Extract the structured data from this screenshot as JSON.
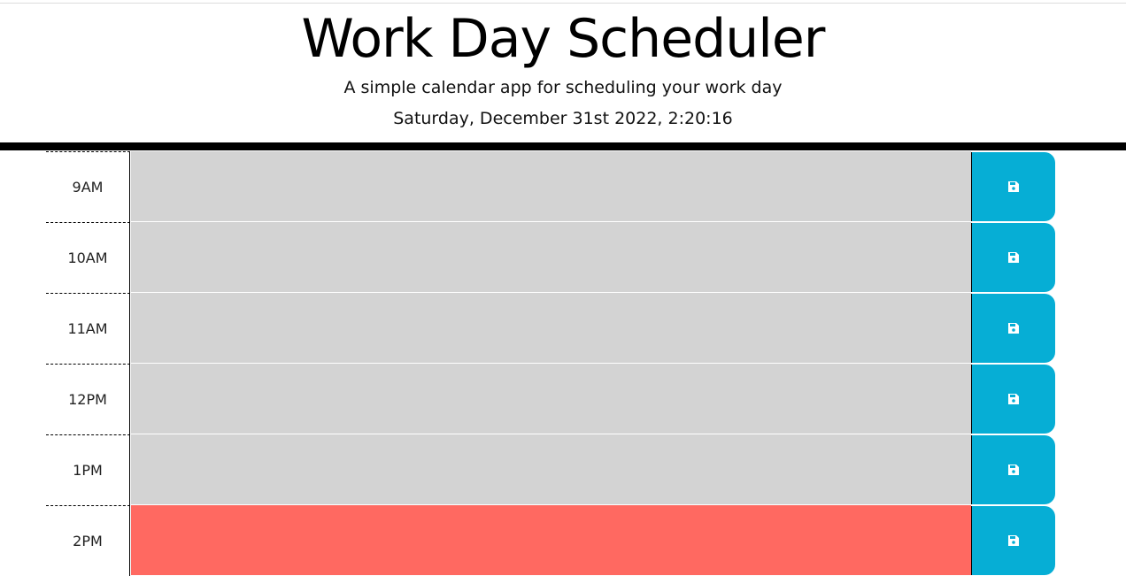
{
  "header": {
    "title": "Work Day Scheduler",
    "subtitle": "A simple calendar app for scheduling your work day",
    "current_day": "Saturday, December 31st 2022, 2:20:16"
  },
  "rows": [
    {
      "hour": "9AM",
      "status": "past",
      "text": ""
    },
    {
      "hour": "10AM",
      "status": "past",
      "text": ""
    },
    {
      "hour": "11AM",
      "status": "past",
      "text": ""
    },
    {
      "hour": "12PM",
      "status": "past",
      "text": ""
    },
    {
      "hour": "1PM",
      "status": "past",
      "text": ""
    },
    {
      "hour": "2PM",
      "status": "present",
      "text": ""
    }
  ],
  "colors": {
    "past": "#d3d3d3",
    "present": "#ff6961",
    "save_button": "#06aed5"
  },
  "icons": {
    "save": "floppy-disk-icon"
  }
}
